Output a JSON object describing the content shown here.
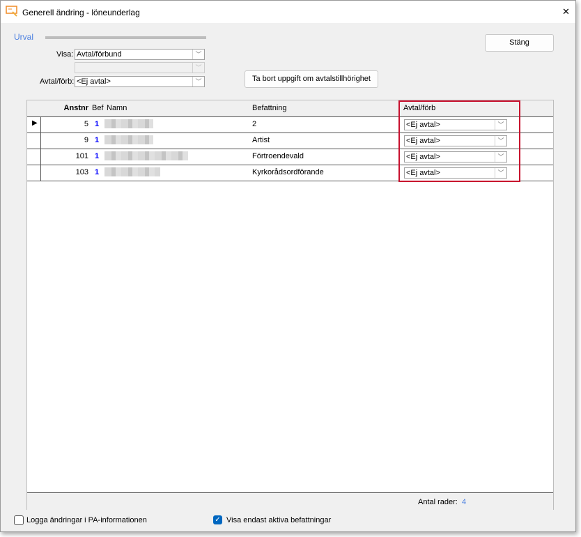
{
  "window": {
    "title": "Generell ändring - löneunderlag",
    "close": "✕"
  },
  "urval": {
    "label": "Urval",
    "visa_label": "Visa:",
    "visa_value": "Avtal/förbund",
    "second_value": "",
    "avtal_label": "Avtal/förb:",
    "avtal_value": "<Ej avtal>"
  },
  "buttons": {
    "stang": "Stäng",
    "ta_bort": "Ta bort uppgift om avtalstillhörighet"
  },
  "grid": {
    "headers": {
      "anstnr": "Anstnr",
      "bef": "Bef",
      "namn": "Namn",
      "befattning": "Befattning",
      "avtal": "Avtal/förb"
    },
    "rows": [
      {
        "anstnr": "5",
        "bef": "1",
        "befattning": "2",
        "avtal": "<Ej avtal>"
      },
      {
        "anstnr": "9",
        "bef": "1",
        "befattning": "Artist",
        "avtal": "<Ej avtal>"
      },
      {
        "anstnr": "101",
        "bef": "1",
        "befattning": "Förtroendevald",
        "avtal": "<Ej avtal>"
      },
      {
        "anstnr": "103",
        "bef": "1",
        "befattning": "Kyrkorådsordförande",
        "avtal": "<Ej avtal>"
      }
    ],
    "footer_label": "Antal rader:",
    "footer_count": "4"
  },
  "options": {
    "logga": "Logga ändringar i PA-informationen",
    "logga_checked": false,
    "visa_aktiva": "Visa endast aktiva befattningar",
    "visa_aktiva_checked": true
  },
  "colors": {
    "accent": "#0067c0",
    "highlight": "#c8102e",
    "link": "#0000ff"
  }
}
